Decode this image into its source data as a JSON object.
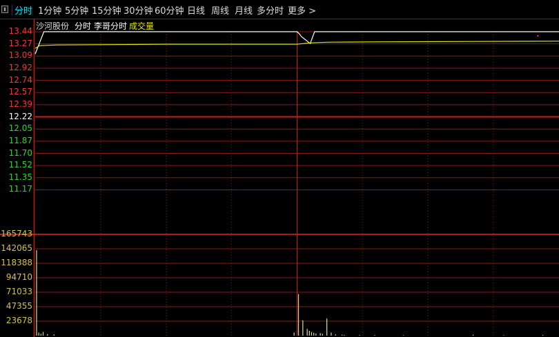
{
  "toolbar": {
    "tabs": [
      {
        "label": "分时",
        "active": true
      },
      {
        "label": "1分钟"
      },
      {
        "label": "5分钟"
      },
      {
        "label": "15分钟"
      },
      {
        "label": "30分钟"
      },
      {
        "label": "60分钟"
      },
      {
        "label": "日线"
      },
      {
        "label": "周线"
      },
      {
        "label": "月线"
      },
      {
        "label": "多分时"
      },
      {
        "label": "更多 >"
      }
    ]
  },
  "header": {
    "stock_name": "沙河股份",
    "view_name": "分时",
    "indicator_name": "李哥分时",
    "volume_label": "成交量"
  },
  "colors": {
    "background": "#000000",
    "grid": "#8b1a1a",
    "grid_strong": "#c41e1e",
    "price_up": "#ff3333",
    "price_flat": "#ffffff",
    "price_down": "#22dd22",
    "price_line": "#ffffff",
    "avg_line": "#e6e600",
    "volume_axis": "#d4c24a",
    "volume_bar": "#dddd88",
    "active_tab": "#00e0ff"
  },
  "chart_data": {
    "type": "line",
    "price_axis": {
      "ticks": [
        "13.44",
        "13.27",
        "13.09",
        "12.92",
        "12.74",
        "12.57",
        "12.39",
        "12.22",
        "12.05",
        "11.87",
        "11.70",
        "11.52",
        "11.35",
        "11.17"
      ],
      "up_ticks": [
        "13.44",
        "13.27",
        "13.09",
        "12.92",
        "12.74",
        "12.57",
        "12.39"
      ],
      "reference_tick": "12.22",
      "down_ticks": [
        "12.05",
        "11.87",
        "11.70",
        "11.52",
        "11.35",
        "11.17"
      ],
      "range": [
        11.085,
        13.44
      ]
    },
    "series": [
      {
        "key": "price",
        "x": [
          0,
          4,
          120,
          121,
          122,
          126,
          128,
          240
        ],
        "values": [
          13.12,
          13.44,
          13.44,
          13.41,
          13.37,
          13.27,
          13.44,
          13.44
        ]
      },
      {
        "key": "avg",
        "x": [
          0,
          2,
          10,
          60,
          120,
          126,
          135,
          160,
          200,
          240
        ],
        "values": [
          13.2,
          13.24,
          13.25,
          13.26,
          13.26,
          13.28,
          13.29,
          13.295,
          13.3,
          13.305
        ]
      }
    ],
    "marker": {
      "x": 230,
      "value": 13.39
    },
    "volume_axis": {
      "ticks": [
        "165743",
        "142065",
        "118388",
        "94710",
        "71033",
        "47355",
        "23678"
      ],
      "max": 165743
    },
    "volume": {
      "x": [
        0,
        1,
        2,
        3,
        5,
        8,
        118,
        120,
        122,
        124,
        125,
        126,
        127,
        128,
        130,
        131,
        133,
        135,
        137,
        140,
        141,
        148,
        155,
        168,
        200,
        214,
        232
      ],
      "values": [
        140000,
        5000,
        3000,
        6000,
        2500,
        2000,
        5000,
        68000,
        25000,
        11000,
        8000,
        6000,
        4500,
        3500,
        4000,
        3000,
        28000,
        5000,
        2000,
        1500,
        1200,
        1000,
        900,
        800,
        1500,
        800,
        1000
      ]
    }
  }
}
